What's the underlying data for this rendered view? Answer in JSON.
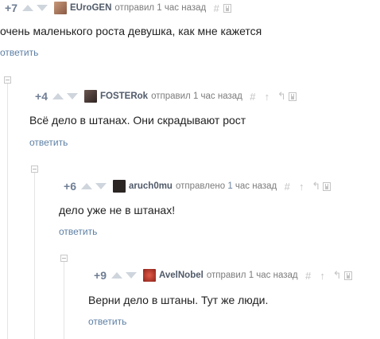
{
  "colors": {
    "rating": "#6f7e94",
    "author": "#505a69",
    "meta": "#7c7c7c",
    "reply_link": "#5c7fa4",
    "body_text": "#1f1f1f",
    "icons": "#c3c3c3"
  },
  "comments": [
    {
      "rating": "+7",
      "author": "EUroGEN",
      "action": "отправил",
      "time": "1 час назад",
      "text": "очень маленького роста девушка, как мне кажется",
      "reply_label": "ответить",
      "avatar_color": "#a3735a",
      "icons": [
        "hash-icon",
        "save-icon"
      ]
    },
    {
      "rating": "+4",
      "author": "FOSTERok",
      "action": "отправил",
      "time": "1 час назад",
      "text": "Всё дело в штанах. Они скрадывают рост",
      "reply_label": "ответить",
      "avatar_color": "#4a3b37",
      "icons": [
        "hash-icon",
        "upvote-arrow-icon",
        "parent-link-icon",
        "save-icon"
      ]
    },
    {
      "rating": "+6",
      "author": "aruch0mu",
      "action_prefix": "отправлено",
      "action_accent": "1",
      "action_suffix": "час назад",
      "text": "дело уже не в штанах!",
      "reply_label": "ответить",
      "avatar_color": "#2b2523",
      "icons": [
        "hash-icon",
        "upvote-arrow-icon",
        "parent-link-icon",
        "save-icon"
      ]
    },
    {
      "rating": "+9",
      "author": "AvelNobel",
      "action": "отправил",
      "time": "1 час назад",
      "text": "Верни дело в штаны. Тут же люди.",
      "reply_label": "ответить",
      "avatar_color": "#b33a2f",
      "icons": [
        "hash-icon",
        "upvote-arrow-icon",
        "parent-link-icon",
        "save-icon"
      ]
    }
  ]
}
